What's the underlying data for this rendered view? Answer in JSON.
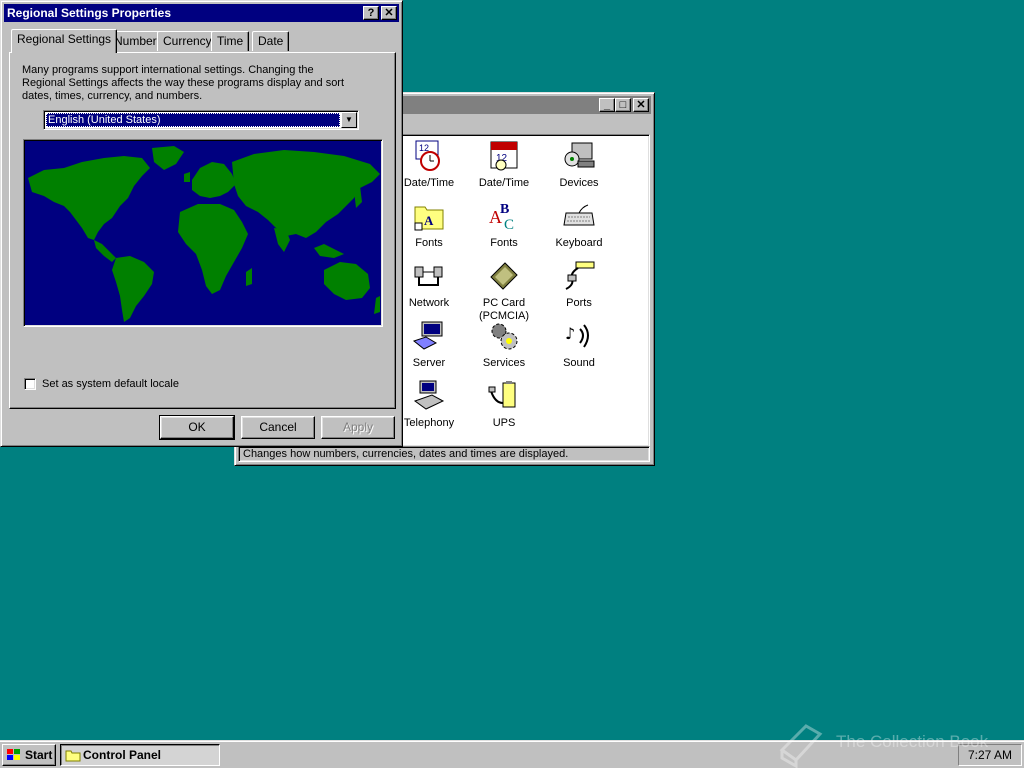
{
  "dialog": {
    "title": "Regional Settings Properties",
    "tabs": [
      "Regional Settings",
      "Number",
      "Currency",
      "Time",
      "Date"
    ],
    "description": "Many programs support international settings. Changing the Regional Settings affects the way these programs display and sort dates, times, currency, and numbers.",
    "locale_value": "English (United States)",
    "checkbox_label": "Set as system default locale",
    "checkbox_checked": false,
    "ok": "OK",
    "cancel": "Cancel",
    "apply": "Apply"
  },
  "control_panel": {
    "status": "Changes how numbers, currencies, dates and times are displayed.",
    "icons": [
      {
        "label": "Date/Time",
        "icon": "clock-icon"
      },
      {
        "label": "Date/Time",
        "icon": "calendar-icon"
      },
      {
        "label": "Devices",
        "icon": "devices-icon"
      },
      {
        "label": "Fonts",
        "icon": "fonts-folder-icon"
      },
      {
        "label": "Fonts",
        "icon": "fonts-abc-icon"
      },
      {
        "label": "Keyboard",
        "icon": "keyboard-icon"
      },
      {
        "label": "Network",
        "icon": "network-icon"
      },
      {
        "label": "PC Card (PCMCIA)",
        "icon": "pc-card-icon"
      },
      {
        "label": "Ports",
        "icon": "ports-icon"
      },
      {
        "label": "Server",
        "icon": "server-icon"
      },
      {
        "label": "Services",
        "icon": "services-icon"
      },
      {
        "label": "Sound",
        "icon": "sound-icon"
      },
      {
        "label": "Telephony",
        "icon": "telephony-icon"
      },
      {
        "label": "UPS",
        "icon": "ups-icon"
      }
    ]
  },
  "taskbar": {
    "start": "Start",
    "task": "Control Panel",
    "clock": "7:27 AM"
  },
  "watermark": "The Collection Book",
  "colors": {
    "desktop": "#008080",
    "title_active": "#000080",
    "map_ocean": "#000080",
    "map_land": "#008000"
  }
}
